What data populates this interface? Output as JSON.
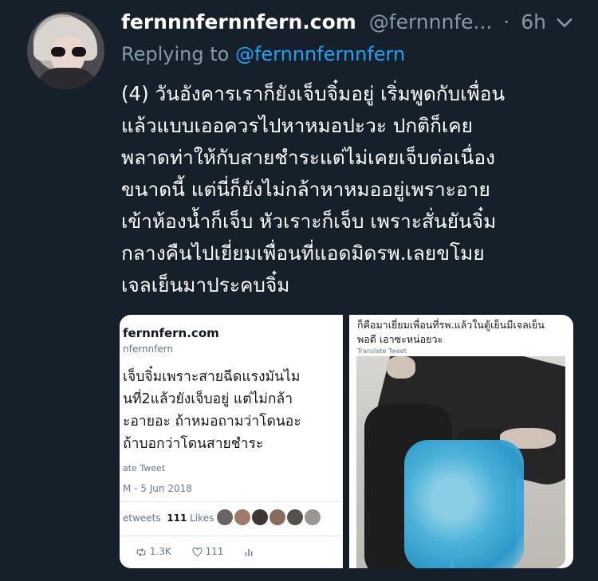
{
  "tweet": {
    "display_name": "fernnnfernnfern.com",
    "handle": "@fernnnfe...",
    "separator": "·",
    "time": "6h",
    "replying_label": "Replying to",
    "replying_to": "@fernnnfernnfern",
    "body_lines": [
      "(4) วันอังคารเราก็ยังเจ็บจิ๋มอยู่ เริ่มพูดกับเพื่อน",
      "แล้วแบบเออควรไปหาหมอปะวะ ปกติก็เคย",
      "พลาดท่าให้กับสายชำระแต่ไม่เคยเจ็บต่อเนื่อง",
      "ขนาดนี้ แต่นี่ก็ยังไม่กล้าหาหมออยู่เพราะอาย",
      "เข้าห้องน้ำก็เจ็บ หัวเราะก็เจ็บ เพราะสั่นยันจิ๋ม",
      "กลางคืนไปเยี่ยมเพื่อนที่แอดมิดรพ.เลยขโมย",
      "เจลเย็นมาประคบจิ๋ม"
    ]
  },
  "media_left": {
    "name": "fernnfern.com",
    "handle": "nfernnfern",
    "text_lines": [
      "เจ็บจิ๋มเพราะสายฉีดแรงมันไม",
      "นที่2แล้วยังเจ็บอยู่ แต่ไม่กล้า",
      "ะอายอะ ถ้าหมอถามว่าโดนอะ",
      "ถ้าบอกว่าโดนสายชำระ"
    ],
    "translate": "ate Tweet",
    "date": "M - 5 Jun 2018",
    "retweets_label": "etweets",
    "likes_count": "111",
    "likes_label": "Likes",
    "reply_count": "1.3K",
    "like_action_count": "111"
  },
  "media_right": {
    "caption_lines": [
      "ก็คือมาเยี่ยมเพื่อนที่รพ.แล้วในตู้เย็นมีเจลเย็น",
      "พอดี เอาซะหน่อยวะ"
    ],
    "translate": "Translate Tweet"
  },
  "icons": {
    "chevron": "chevron-down-icon",
    "retweet": "retweet-icon",
    "like": "heart-icon",
    "stats": "analytics-icon"
  },
  "colors": {
    "background": "#15202b",
    "secondary_text": "#8899a6",
    "mention": "#1da1f2"
  }
}
